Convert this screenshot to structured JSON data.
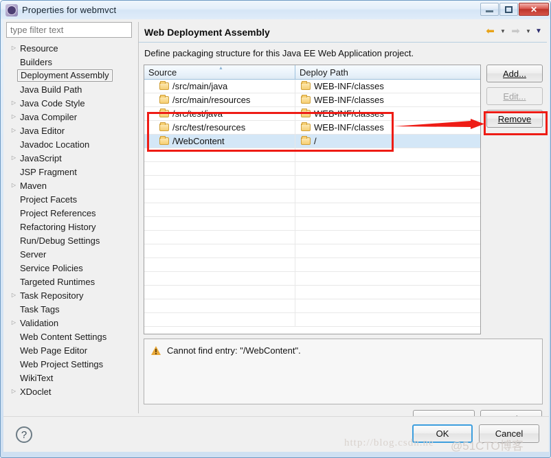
{
  "window": {
    "title": "Properties for webmvct",
    "app_icon": "gear-icon",
    "minimize_label": "",
    "restore_label": "",
    "close_label": "✕"
  },
  "sidebar": {
    "filter": {
      "value": "",
      "placeholder": "type filter text"
    },
    "items": [
      {
        "label": "Resource",
        "expandable": true,
        "selected": false
      },
      {
        "label": "Builders",
        "expandable": false,
        "selected": false
      },
      {
        "label": "Deployment Assembly",
        "expandable": false,
        "selected": true
      },
      {
        "label": "Java Build Path",
        "expandable": false,
        "selected": false
      },
      {
        "label": "Java Code Style",
        "expandable": true,
        "selected": false
      },
      {
        "label": "Java Compiler",
        "expandable": true,
        "selected": false
      },
      {
        "label": "Java Editor",
        "expandable": true,
        "selected": false
      },
      {
        "label": "Javadoc Location",
        "expandable": false,
        "selected": false
      },
      {
        "label": "JavaScript",
        "expandable": true,
        "selected": false
      },
      {
        "label": "JSP Fragment",
        "expandable": false,
        "selected": false
      },
      {
        "label": "Maven",
        "expandable": true,
        "selected": false
      },
      {
        "label": "Project Facets",
        "expandable": false,
        "selected": false
      },
      {
        "label": "Project References",
        "expandable": false,
        "selected": false
      },
      {
        "label": "Refactoring History",
        "expandable": false,
        "selected": false
      },
      {
        "label": "Run/Debug Settings",
        "expandable": false,
        "selected": false
      },
      {
        "label": "Server",
        "expandable": false,
        "selected": false
      },
      {
        "label": "Service Policies",
        "expandable": false,
        "selected": false
      },
      {
        "label": "Targeted Runtimes",
        "expandable": false,
        "selected": false
      },
      {
        "label": "Task Repository",
        "expandable": true,
        "selected": false
      },
      {
        "label": "Task Tags",
        "expandable": false,
        "selected": false
      },
      {
        "label": "Validation",
        "expandable": true,
        "selected": false
      },
      {
        "label": "Web Content Settings",
        "expandable": false,
        "selected": false
      },
      {
        "label": "Web Page Editor",
        "expandable": false,
        "selected": false
      },
      {
        "label": "Web Project Settings",
        "expandable": false,
        "selected": false
      },
      {
        "label": "WikiText",
        "expandable": false,
        "selected": false
      },
      {
        "label": "XDoclet",
        "expandable": true,
        "selected": false
      }
    ]
  },
  "page": {
    "title": "Web Deployment Assembly",
    "description": "Define packaging structure for this Java EE Web Application project.",
    "nav": {
      "back_icon": "back-arrow-icon",
      "back_caret": "chevron-down-icon",
      "forward_icon": "forward-arrow-icon",
      "forward_caret": "chevron-down-icon",
      "menu_caret": "chevron-down-icon"
    }
  },
  "table": {
    "columns": [
      "Source",
      "Deploy Path"
    ],
    "sort_column": "Source",
    "sort_indicator": "▲",
    "rows": [
      {
        "source": "/src/main/java",
        "deploy": "WEB-INF/classes",
        "selected": false
      },
      {
        "source": "/src/main/resources",
        "deploy": "WEB-INF/classes",
        "selected": false
      },
      {
        "source": "/src/test/java",
        "deploy": "WEB-INF/classes",
        "selected": false
      },
      {
        "source": "/src/test/resources",
        "deploy": "WEB-INF/classes",
        "selected": false
      },
      {
        "source": "/WebContent",
        "deploy": "/",
        "selected": true
      }
    ],
    "empty_rows": 13
  },
  "side_buttons": [
    {
      "label": "Add...",
      "mnemonic": "d",
      "enabled": true
    },
    {
      "label": "Edit...",
      "mnemonic": "E",
      "enabled": false
    },
    {
      "label": "Remove",
      "mnemonic": "R",
      "enabled": true
    }
  ],
  "message": {
    "icon": "warning-icon",
    "text": "Cannot find entry: \"/WebContent\"."
  },
  "apply_buttons": [
    {
      "label": "Revert"
    },
    {
      "label": "Apply"
    }
  ],
  "footer": {
    "help_icon": "question-mark-icon",
    "buttons": [
      {
        "label": "OK",
        "default": true
      },
      {
        "label": "Cancel",
        "default": false
      }
    ]
  },
  "annotations": {
    "red_box_rows": "rows 3-5 highlighted",
    "arrow_target": "Remove"
  },
  "watermarks": {
    "url": "http://blog.csdn.ne",
    "site": "@51CTO博客"
  },
  "colors": {
    "accent": "#3c9ede",
    "annotation_red": "#ee1c15",
    "selection": "#d4e7f7",
    "warning": "#e8a93a"
  }
}
